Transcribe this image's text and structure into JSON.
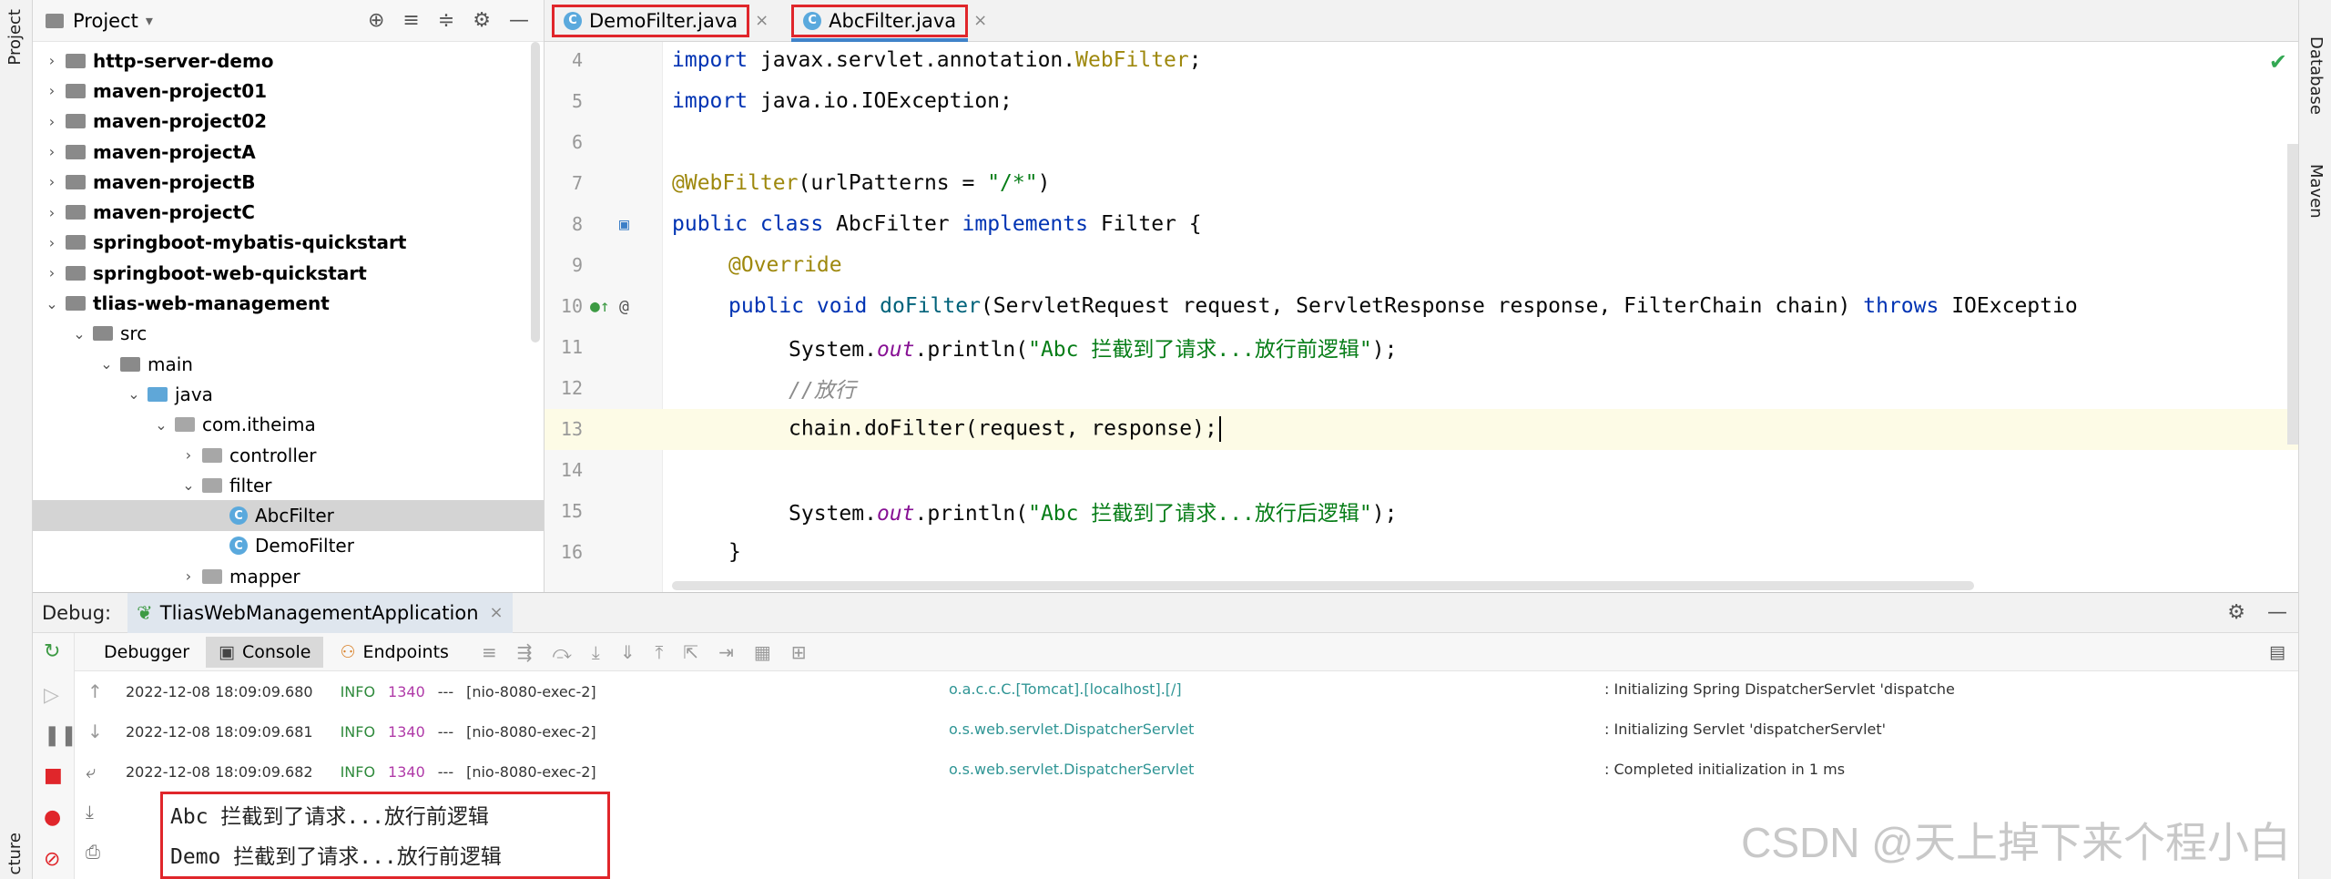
{
  "left_stripe": {
    "project_label": "Project",
    "structure_label": "cture"
  },
  "right_stripe": {
    "database_label": "Database",
    "maven_label": "Maven"
  },
  "project_panel": {
    "title": "Project",
    "tree": [
      {
        "label": "http-server-demo",
        "level": 0,
        "kind": "module",
        "arrow": "›"
      },
      {
        "label": "maven-project01",
        "level": 0,
        "kind": "module",
        "arrow": "›"
      },
      {
        "label": "maven-project02",
        "level": 0,
        "kind": "module",
        "arrow": "›"
      },
      {
        "label": "maven-projectA",
        "level": 0,
        "kind": "module",
        "arrow": "›"
      },
      {
        "label": "maven-projectB",
        "level": 0,
        "kind": "module",
        "arrow": "›"
      },
      {
        "label": "maven-projectC",
        "level": 0,
        "kind": "module",
        "arrow": "›"
      },
      {
        "label": "springboot-mybatis-quickstart",
        "level": 0,
        "kind": "module",
        "arrow": "›"
      },
      {
        "label": "springboot-web-quickstart",
        "level": 0,
        "kind": "module",
        "arrow": "›"
      },
      {
        "label": "tlias-web-management",
        "level": 0,
        "kind": "module",
        "arrow": "⌄"
      },
      {
        "label": "src",
        "level": 1,
        "kind": "folder",
        "arrow": "⌄"
      },
      {
        "label": "main",
        "level": 2,
        "kind": "folder",
        "arrow": "⌄"
      },
      {
        "label": "java",
        "level": 3,
        "kind": "source",
        "arrow": "⌄"
      },
      {
        "label": "com.itheima",
        "level": 4,
        "kind": "package",
        "arrow": "⌄"
      },
      {
        "label": "controller",
        "level": 5,
        "kind": "package",
        "arrow": "›"
      },
      {
        "label": "filter",
        "level": 5,
        "kind": "package",
        "arrow": "⌄"
      },
      {
        "label": "AbcFilter",
        "level": 6,
        "kind": "class",
        "arrow": ""
      },
      {
        "label": "DemoFilter",
        "level": 6,
        "kind": "class",
        "arrow": ""
      },
      {
        "label": "mapper",
        "level": 5,
        "kind": "package",
        "arrow": "›"
      }
    ]
  },
  "editor": {
    "tabs": [
      {
        "label": "DemoFilter.java",
        "active": false
      },
      {
        "label": "AbcFilter.java",
        "active": true
      }
    ],
    "lines": [
      {
        "num": "4"
      },
      {
        "num": "5"
      },
      {
        "num": "6"
      },
      {
        "num": "7"
      },
      {
        "num": "8"
      },
      {
        "num": "9"
      },
      {
        "num": "10"
      },
      {
        "num": "11"
      },
      {
        "num": "12"
      },
      {
        "num": "13"
      },
      {
        "num": "14"
      },
      {
        "num": "15"
      },
      {
        "num": "16"
      }
    ],
    "code": {
      "l4_kw": "import ",
      "l4_pkg": "javax.servlet.annotation.",
      "l4_ann": "WebFilter",
      "l4_end": ";",
      "l5_kw": "import ",
      "l5_pkg": "java.io.IOException;",
      "l7_ann": "@WebFilter",
      "l7_open": "(urlPatterns = ",
      "l7_str": "\"/*\"",
      "l7_close": ")",
      "l8_kw1": "public class ",
      "l8_name": "AbcFilter ",
      "l8_kw2": "implements ",
      "l8_rest": "Filter {",
      "l9_ann": "@Override",
      "l10_kw": "public void ",
      "l10_method": "doFilter",
      "l10_params": "(ServletRequest request, ServletResponse response, FilterChain chain) ",
      "l10_throws": "throws ",
      "l10_exc": "IOExceptio",
      "l11_pre": "System.",
      "l11_fld": "out",
      "l11_call": ".println(",
      "l11_str": "\"Abc 拦截到了请求...放行前逻辑\"",
      "l11_end": ");",
      "l12_com": "//放行",
      "l13_text": "chain.doFilter(request, response);",
      "l15_pre": "System.",
      "l15_fld": "out",
      "l15_call": ".println(",
      "l15_str": "\"Abc 拦截到了请求...放行后逻辑\"",
      "l15_end": ");",
      "l16_text": "}"
    }
  },
  "debug": {
    "title": "Debug:",
    "run_config": "TliasWebManagementApplication",
    "tabs": [
      {
        "label": "Debugger"
      },
      {
        "label": "Console"
      },
      {
        "label": "Endpoints"
      }
    ],
    "logs": [
      {
        "ts": "2022-12-08 18:09:09.680",
        "lvl": "INFO",
        "pid": "1340",
        "dashes": "---",
        "thread": "[nio-8080-exec-2]",
        "logger": "o.a.c.c.C.[Tomcat].[localhost].[/]",
        "msg": ": Initializing Spring DispatcherServlet 'dispatche"
      },
      {
        "ts": "2022-12-08 18:09:09.681",
        "lvl": "INFO",
        "pid": "1340",
        "dashes": "---",
        "thread": "[nio-8080-exec-2]",
        "logger": "o.s.web.servlet.DispatcherServlet",
        "msg": ": Initializing Servlet 'dispatcherServlet'"
      },
      {
        "ts": "2022-12-08 18:09:09.682",
        "lvl": "INFO",
        "pid": "1340",
        "dashes": "---",
        "thread": "[nio-8080-exec-2]",
        "logger": "o.s.web.servlet.DispatcherServlet",
        "msg": ": Completed initialization in 1 ms"
      }
    ],
    "output": [
      "Abc 拦截到了请求...放行前逻辑",
      "Demo 拦截到了请求...放行前逻辑"
    ]
  },
  "watermark": "CSDN @天上掉下来个程小白",
  "colors": {
    "highlight_border": "#e0262b",
    "keyword": "#0033b3",
    "string": "#067d17",
    "annotation": "#9e880d"
  }
}
